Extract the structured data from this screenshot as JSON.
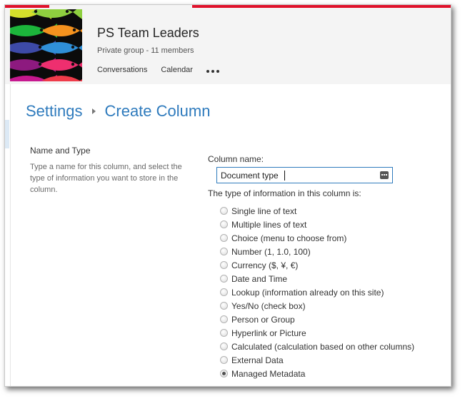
{
  "group": {
    "title": "PS Team Leaders",
    "subtitle": "Private group - 11 members",
    "nav": [
      "Conversations",
      "Calendar"
    ]
  },
  "breadcrumb": {
    "parent": "Settings",
    "current": "Create Column"
  },
  "section": {
    "title": "Name and Type",
    "description": "Type a name for this column, and select the type of information you want to store in the column."
  },
  "column_name": {
    "label": "Column name:",
    "value": "Document type"
  },
  "type_question": "The type of information in this column is:",
  "types": [
    {
      "label": "Single line of text",
      "checked": false
    },
    {
      "label": "Multiple lines of text",
      "checked": false
    },
    {
      "label": "Choice (menu to choose from)",
      "checked": false
    },
    {
      "label": "Number (1, 1.0, 100)",
      "checked": false
    },
    {
      "label": "Currency ($, ¥, €)",
      "checked": false
    },
    {
      "label": "Date and Time",
      "checked": false
    },
    {
      "label": "Lookup (information already on this site)",
      "checked": false
    },
    {
      "label": "Yes/No (check box)",
      "checked": false
    },
    {
      "label": "Person or Group",
      "checked": false
    },
    {
      "label": "Hyperlink or Picture",
      "checked": false
    },
    {
      "label": "Calculated (calculation based on other columns)",
      "checked": false
    },
    {
      "label": "External Data",
      "checked": false
    },
    {
      "label": "Managed Metadata",
      "checked": true
    }
  ],
  "colors": {
    "accent": "#2f7bbd",
    "header_bg": "#f4f4f4",
    "top_strip": "#e0112b"
  },
  "icons": {
    "logo": "fish-logo",
    "more": "more-icon",
    "field_menu": "field-options-icon",
    "breadcrumb_separator": "chevron-right-icon"
  }
}
